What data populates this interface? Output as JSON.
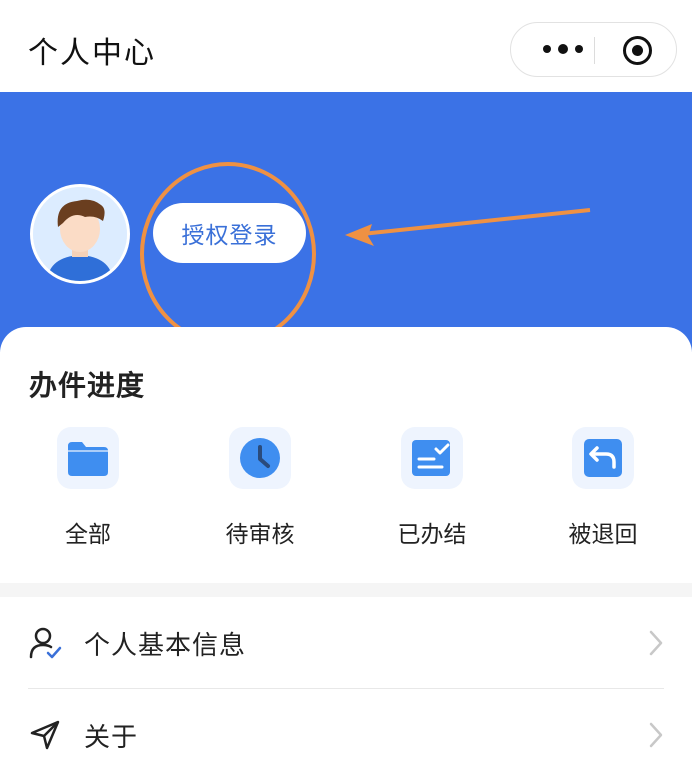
{
  "navbar": {
    "title": "个人中心"
  },
  "hero": {
    "login_label": "授权登录"
  },
  "progress": {
    "title": "办件进度",
    "items": [
      {
        "label": "全部",
        "icon": "folder-icon"
      },
      {
        "label": "待审核",
        "icon": "clock-icon"
      },
      {
        "label": "已办结",
        "icon": "done-list-icon"
      },
      {
        "label": "被退回",
        "icon": "return-icon"
      }
    ]
  },
  "menu": {
    "items": [
      {
        "label": "个人基本信息",
        "icon": "user-check-icon"
      },
      {
        "label": "关于",
        "icon": "send-icon"
      }
    ]
  },
  "colors": {
    "brand_blue": "#3b72e6",
    "annotation_orange": "#ef9143",
    "icon_blue": "#3f8ef0"
  }
}
